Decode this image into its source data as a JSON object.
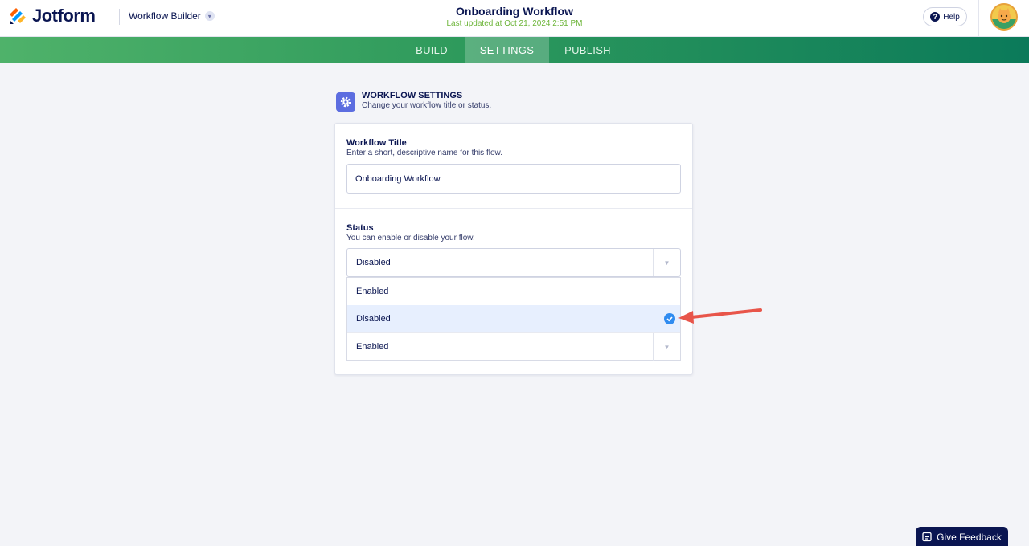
{
  "header": {
    "brand": "Jotform",
    "builder_label": "Workflow Builder",
    "title": "Onboarding Workflow",
    "last_updated": "Last updated at Oct 21, 2024 2:51 PM",
    "help_label": "Help"
  },
  "tabs": [
    {
      "label": "BUILD",
      "active": false
    },
    {
      "label": "SETTINGS",
      "active": true
    },
    {
      "label": "PUBLISH",
      "active": false
    }
  ],
  "settings": {
    "section_title": "WORKFLOW SETTINGS",
    "section_subtitle": "Change your workflow title or status.",
    "title_field": {
      "label": "Workflow Title",
      "hint": "Enter a short, descriptive name for this flow.",
      "value": "Onboarding Workflow"
    },
    "status_field": {
      "label": "Status",
      "hint": "You can enable or disable your flow.",
      "selected": "Disabled",
      "options": [
        "Enabled",
        "Disabled",
        "Enabled"
      ]
    }
  },
  "feedback_label": "Give Feedback",
  "colors": {
    "brand_navy": "#0a1551",
    "tab_gradient_start": "#4fb26a",
    "tab_gradient_end": "#0b7a5a",
    "settings_icon_bg": "#5c6de0",
    "check_blue": "#2f8bf0",
    "annotation_red": "#e8554a"
  }
}
